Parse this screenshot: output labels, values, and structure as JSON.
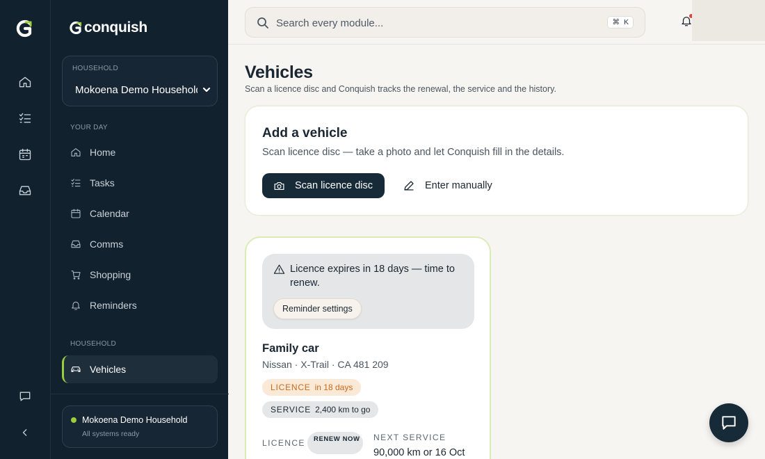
{
  "app": {
    "brand": "conquish"
  },
  "rail": {
    "items": [
      {
        "icon": "home-icon"
      },
      {
        "icon": "tasks-icon"
      },
      {
        "icon": "calendar-icon"
      },
      {
        "icon": "inbox-icon"
      }
    ],
    "bottom": [
      {
        "icon": "chat-icon"
      },
      {
        "icon": "collapse-icon"
      }
    ]
  },
  "sidebar": {
    "household_select": {
      "label": "HOUSEHOLD",
      "value": "Mokoena Demo Household"
    },
    "section_your_day": "YOUR DAY",
    "items": [
      {
        "label": "Home",
        "icon": "home-icon"
      },
      {
        "label": "Tasks",
        "icon": "tasks-icon"
      },
      {
        "label": "Calendar",
        "icon": "calendar-icon"
      },
      {
        "label": "Comms",
        "icon": "inbox-icon"
      },
      {
        "label": "Shopping",
        "icon": "cart-icon"
      },
      {
        "label": "Reminders",
        "icon": "bell-icon"
      }
    ],
    "section_household": "HOUSEHOLD",
    "household_items": [
      {
        "label": "Vehicles",
        "icon": "car-icon",
        "active": true
      }
    ],
    "footer": {
      "name": "Mokoena Demo Household",
      "status": "All systems ready"
    }
  },
  "topbar": {
    "search_placeholder": "Search every module...",
    "shortcut": {
      "mod": "⌘",
      "key": "K"
    }
  },
  "main": {
    "title": "Vehicles",
    "subtitle": "Scan a licence disc and Conquish tracks the renewal, the service and the history.",
    "add_card": {
      "title": "Add a vehicle",
      "description": "Scan licence disc — take a photo and let Conquish fill in the details.",
      "scan_label": "Scan licence disc",
      "manual_label": "Enter manually"
    },
    "vehicle": {
      "alert": "Licence expires in 18 days — time to renew.",
      "reminder_button": "Reminder settings",
      "name": "Family car",
      "meta": "Nissan · X-Trail · CA 481 209",
      "licence_chip": {
        "key": "LICENCE",
        "value": "in 18 days"
      },
      "service_chip": {
        "key": "SERVICE",
        "value": "2,400 km to go"
      },
      "licence_label": "LICENCE",
      "licence_badge": "RENEW NOW",
      "next_service_label": "NEXT SERVICE",
      "next_service_value": "90,000 km or 16 Oct"
    }
  },
  "colors": {
    "accent": "#9ccd3c",
    "navy": "#12212e",
    "warning": "#c86a18"
  }
}
